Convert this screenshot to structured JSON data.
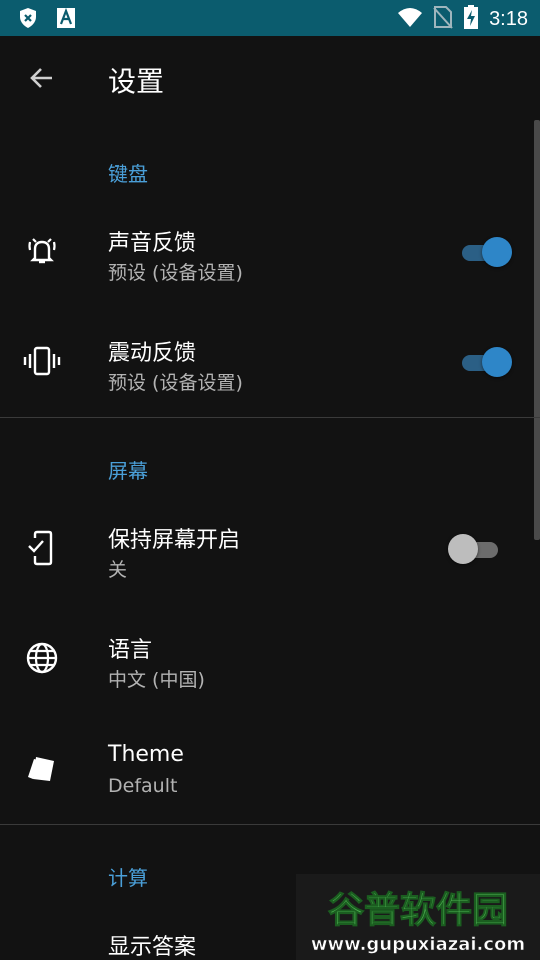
{
  "statusbar": {
    "time": "3:18",
    "left_icons": [
      "shield-x-icon",
      "a-box-icon"
    ],
    "right_icons": [
      "wifi-icon",
      "no-sim-icon",
      "battery-charging-icon"
    ]
  },
  "appbar": {
    "title": "设置"
  },
  "sections": {
    "keyboard": {
      "header": "键盘"
    },
    "screen": {
      "header": "屏幕"
    },
    "calc": {
      "header": "计算"
    }
  },
  "items": {
    "sound": {
      "title": "声音反馈",
      "subtitle": "预设 (设备设置)",
      "on": true
    },
    "vibration": {
      "title": "震动反馈",
      "subtitle": "预设 (设备设置)",
      "on": true
    },
    "screen_on": {
      "title": "保持屏幕开启",
      "subtitle": "关",
      "on": false
    },
    "language": {
      "title": "语言",
      "subtitle": "中文 (中国)"
    },
    "theme": {
      "title": "Theme",
      "subtitle": "Default"
    },
    "show_answer": {
      "title": "显示答案"
    }
  },
  "watermark": {
    "line1": "谷普软件园",
    "line2": "www.gupuxiazai.com"
  },
  "colors": {
    "accent": "#4a9fd8",
    "status_bar": "#0b5c6e",
    "background": "#121212",
    "toggle_on": "#2e86c8"
  }
}
